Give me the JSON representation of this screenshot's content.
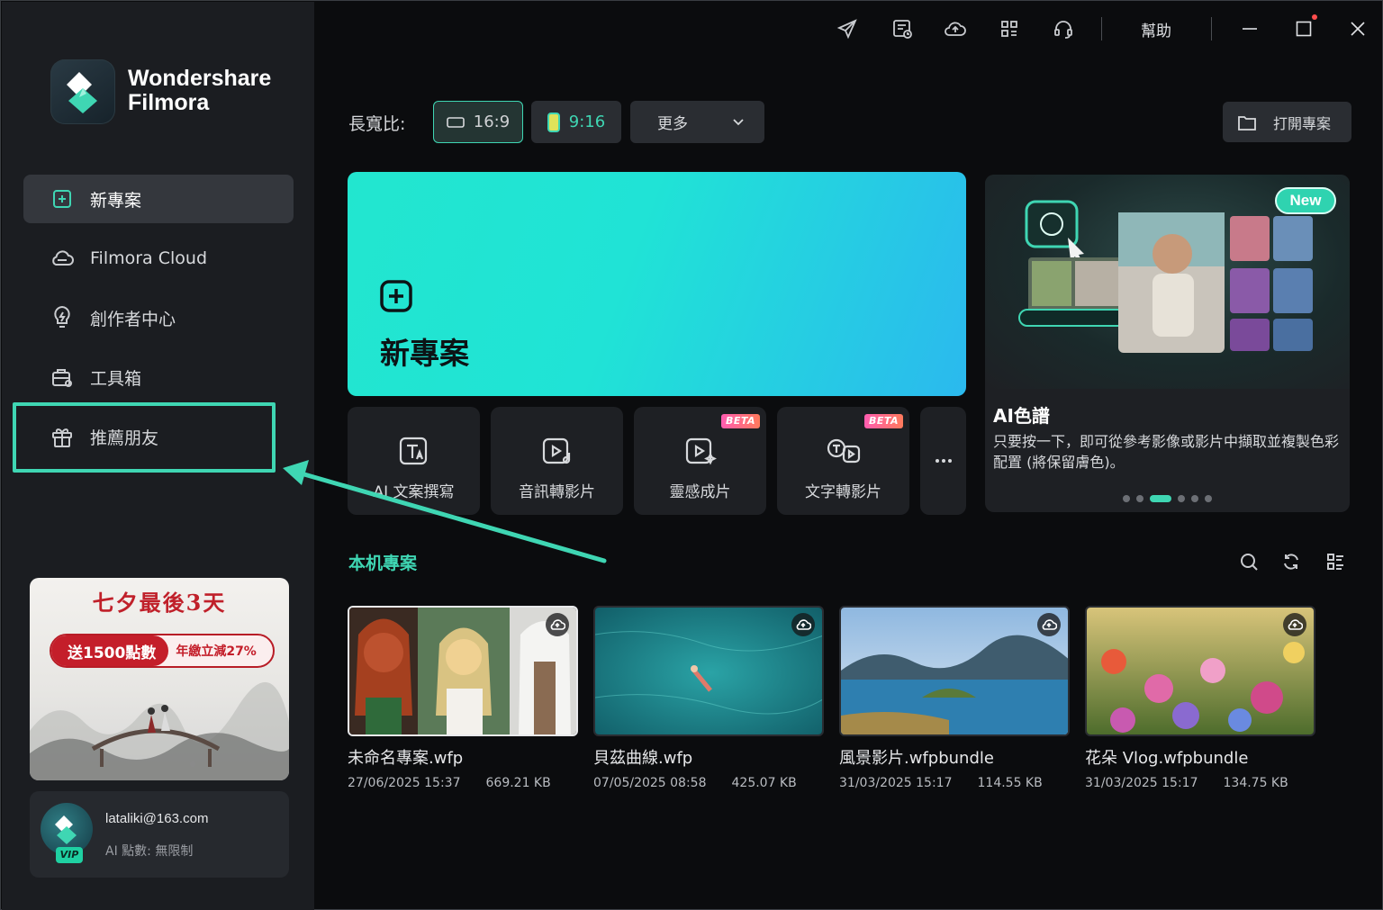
{
  "app": {
    "brand_line1": "Wondershare",
    "brand_line2": "Filmora"
  },
  "sidebar": {
    "items": [
      {
        "label": "新專案",
        "icon": "new-project-icon",
        "active": true
      },
      {
        "label": "Filmora Cloud",
        "icon": "cloud-icon",
        "active": false
      },
      {
        "label": "創作者中心",
        "icon": "lightbulb-icon",
        "active": false
      },
      {
        "label": "工具箱",
        "icon": "toolbox-icon",
        "active": false
      },
      {
        "label": "推薦朋友",
        "icon": "gift-icon",
        "active": false
      }
    ],
    "promo": {
      "title": "七夕最後3天",
      "pill_left": "送1500點數",
      "pill_right": "年繳立減27%"
    },
    "account": {
      "email": "lataliki@163.com",
      "ai_points": "AI 點數: 無限制",
      "badge": "VIP"
    }
  },
  "titlebar": {
    "icons": [
      "send-icon",
      "feedback-icon",
      "cloud-sync-icon",
      "apps-grid-icon",
      "headset-icon"
    ],
    "help_label": "幫助"
  },
  "aspect": {
    "label": "長寬比:",
    "options": [
      "16:9",
      "9:16"
    ],
    "selected": "16:9",
    "more_label": "更多",
    "open_project_label": "打開專案"
  },
  "hero": {
    "title": "新專案"
  },
  "tools": [
    {
      "label": "AI 文案撰寫",
      "icon": "ai-text-icon",
      "beta": false
    },
    {
      "label": "音訊轉影片",
      "icon": "audio-to-video-icon",
      "beta": false
    },
    {
      "label": "靈感成片",
      "icon": "idea-to-video-icon",
      "beta": true
    },
    {
      "label": "文字轉影片",
      "icon": "text-to-video-icon",
      "beta": true
    }
  ],
  "beta_label": "BETA",
  "feature": {
    "badge": "New",
    "title": "AI色譜",
    "description": "只要按一下，即可從參考影像或影片中擷取並複製色彩配置 (將保留膚色)。",
    "page_count": 6,
    "active_page": 3
  },
  "local": {
    "title": "本机專案",
    "projects": [
      {
        "name": "未命名專案.wfp",
        "date": "27/06/2025 15:37",
        "size": "669.21 KB"
      },
      {
        "name": "貝茲曲線.wfp",
        "date": "07/05/2025 08:58",
        "size": "425.07 KB"
      },
      {
        "name": "風景影片.wfpbundle",
        "date": "31/03/2025 15:17",
        "size": "114.55 KB"
      },
      {
        "name": "花朵 Vlog.wfpbundle",
        "date": "31/03/2025 15:17",
        "size": "134.75 KB"
      }
    ]
  },
  "colors": {
    "accent": "#3fd6b3",
    "sidebar_bg": "#1b1d21",
    "main_bg": "#0b0c0e",
    "card_bg": "#1e2024"
  }
}
